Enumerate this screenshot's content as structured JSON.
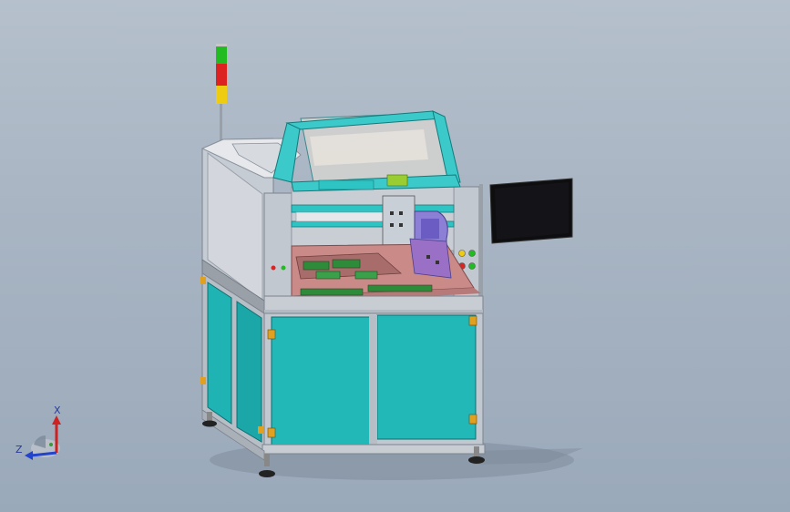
{
  "viewport": {
    "type": "cad-3d-viewport",
    "background": "#a9b5c3"
  },
  "triad": {
    "x_label": "X",
    "z_label": "Z",
    "x_color": "#cc2222",
    "z_color": "#2244cc"
  },
  "colors": {
    "frame": "#c6ccd4",
    "frame_dark": "#8e96a0",
    "panel_cyan": "#1fb3b3",
    "panel_cyan_dark": "#128a8c",
    "top_cover": "#d8d8dc",
    "cover_frame": "#3cc9c9",
    "bed": "#c98a88",
    "pcb_green": "#2e8b3a",
    "monitor": "#0e0e10",
    "signal_green": "#22bb22",
    "signal_red": "#dd2222",
    "signal_yellow": "#eecc11"
  },
  "model": {
    "name_icon": "pcb-machine-model",
    "signal_tower_icon": "signal-tower-icon",
    "monitor_icon": "monitor-icon"
  }
}
